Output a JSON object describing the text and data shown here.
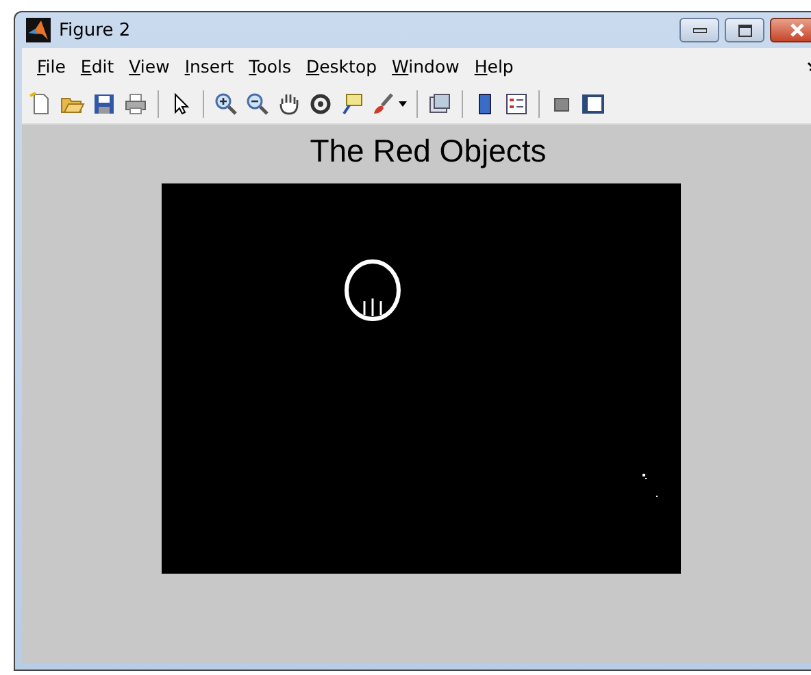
{
  "window": {
    "title": "Figure 2"
  },
  "menu": [
    "File",
    "Edit",
    "View",
    "Insert",
    "Tools",
    "Desktop",
    "Window",
    "Help"
  ],
  "figure": {
    "title": "The Red Objects"
  }
}
